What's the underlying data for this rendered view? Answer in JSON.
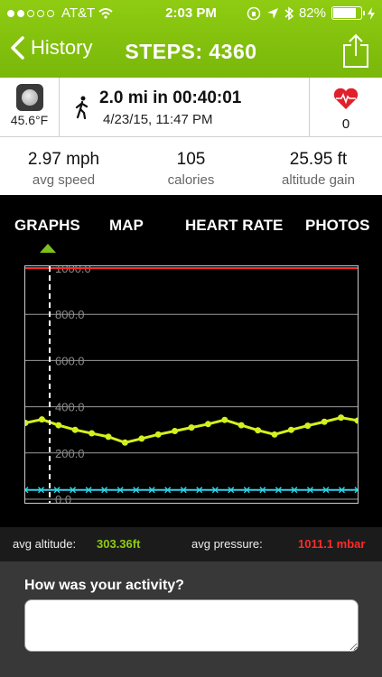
{
  "status_bar": {
    "carrier": "AT&T",
    "time": "2:03 PM",
    "battery": "82%",
    "signal_bars_on": 2,
    "signal_bars_total": 5,
    "battery_level": 0.82
  },
  "nav": {
    "back_label": "History",
    "title": "STEPS: 4360",
    "icons": [
      "chevron-left-icon",
      "share-icon"
    ]
  },
  "summary": {
    "temperature": "45.6°F",
    "activity": "2.0 mi in 00:40:01",
    "datetime": "4/23/15, 11:47 PM",
    "heart_count": "0",
    "icons": [
      "moon-weather-icon",
      "walking-icon",
      "heart-pulse-icon"
    ]
  },
  "stats": [
    {
      "value": "2.97 mph",
      "label": "avg speed"
    },
    {
      "value": "105",
      "label": "calories"
    },
    {
      "value": "25.95 ft",
      "label": "altitude gain"
    }
  ],
  "tabs": [
    "GRAPHS",
    "MAP",
    "HEART RATE",
    "PHOTOS"
  ],
  "active_tab": "GRAPHS",
  "chart_data": {
    "type": "line",
    "yticks": [
      "1000.0",
      "800.0",
      "600.0",
      "400.0",
      "200.0",
      "0.0"
    ],
    "ylim": [
      0,
      1000
    ],
    "grid": true,
    "series": [
      {
        "color": "#d4f01e",
        "marker": "circle",
        "values": [
          330,
          345,
          320,
          300,
          285,
          270,
          245,
          262,
          280,
          295,
          310,
          325,
          343,
          320,
          298,
          280,
          300,
          318,
          335,
          353,
          340
        ]
      },
      {
        "color": "#2fd3e6",
        "marker": "x",
        "values": [
          40,
          40,
          40,
          40,
          40,
          40,
          40,
          40,
          40,
          40,
          40,
          40,
          40,
          40,
          40,
          40,
          40,
          40,
          40,
          40,
          40,
          40
        ]
      },
      {
        "color": "#ff2a2a",
        "values": [
          1000,
          1000
        ]
      }
    ],
    "cursor": "dashed vertical marker"
  },
  "averages": {
    "altitude_label": "avg altitude:",
    "altitude_value": "303.36ft",
    "pressure_label": "avg pressure:",
    "pressure_value": "1011.1 mbar"
  },
  "feedback": {
    "question": "How was your activity?",
    "input_value": ""
  },
  "colors": {
    "accent_green": "#8fcc12",
    "altitude_green": "#d4f01e",
    "pressure_red": "#ff2a2a",
    "cyan": "#2fd3e6"
  }
}
